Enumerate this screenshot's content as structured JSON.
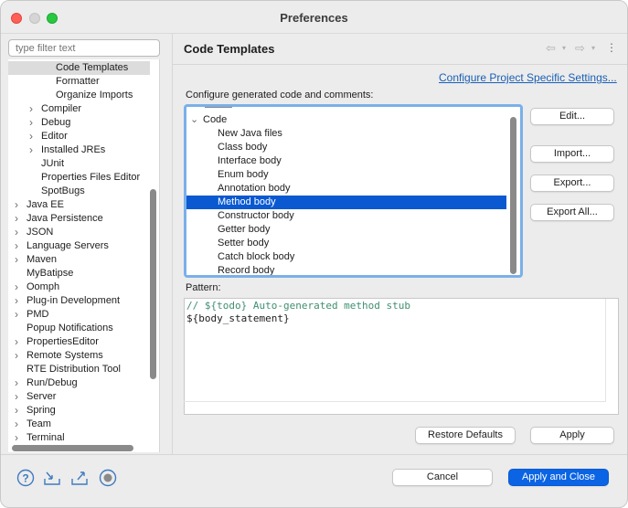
{
  "window": {
    "title": "Preferences"
  },
  "filter": {
    "placeholder": "type filter text"
  },
  "tree": [
    {
      "label": "Code Templates",
      "indent": 3,
      "chevron": "",
      "selected": true
    },
    {
      "label": "Formatter",
      "indent": 3,
      "chevron": ""
    },
    {
      "label": "Organize Imports",
      "indent": 3,
      "chevron": ""
    },
    {
      "label": "Compiler",
      "indent": 2,
      "chevron": "›"
    },
    {
      "label": "Debug",
      "indent": 2,
      "chevron": "›"
    },
    {
      "label": "Editor",
      "indent": 2,
      "chevron": "›"
    },
    {
      "label": "Installed JREs",
      "indent": 2,
      "chevron": "›"
    },
    {
      "label": "JUnit",
      "indent": 2,
      "chevron": ""
    },
    {
      "label": "Properties Files Editor",
      "indent": 2,
      "chevron": ""
    },
    {
      "label": "SpotBugs",
      "indent": 2,
      "chevron": ""
    },
    {
      "label": "Java EE",
      "indent": 1,
      "chevron": "›"
    },
    {
      "label": "Java Persistence",
      "indent": 1,
      "chevron": "›"
    },
    {
      "label": "JSON",
      "indent": 1,
      "chevron": "›"
    },
    {
      "label": "Language Servers",
      "indent": 1,
      "chevron": "›"
    },
    {
      "label": "Maven",
      "indent": 1,
      "chevron": "›"
    },
    {
      "label": "MyBatipse",
      "indent": 1,
      "chevron": ""
    },
    {
      "label": "Oomph",
      "indent": 1,
      "chevron": "›"
    },
    {
      "label": "Plug-in Development",
      "indent": 1,
      "chevron": "›"
    },
    {
      "label": "PMD",
      "indent": 1,
      "chevron": "›"
    },
    {
      "label": "Popup Notifications",
      "indent": 1,
      "chevron": ""
    },
    {
      "label": "PropertiesEditor",
      "indent": 1,
      "chevron": "›"
    },
    {
      "label": "Remote Systems",
      "indent": 1,
      "chevron": "›"
    },
    {
      "label": "RTE Distribution Tool",
      "indent": 1,
      "chevron": ""
    },
    {
      "label": "Run/Debug",
      "indent": 1,
      "chevron": "›"
    },
    {
      "label": "Server",
      "indent": 1,
      "chevron": "›"
    },
    {
      "label": "Spring",
      "indent": 1,
      "chevron": "›"
    },
    {
      "label": "Team",
      "indent": 1,
      "chevron": "›"
    },
    {
      "label": "Terminal",
      "indent": 1,
      "chevron": "›"
    }
  ],
  "page": {
    "title": "Code Templates",
    "link": "Configure Project Specific Settings...",
    "configure_label": "Configure generated code and comments:",
    "pattern_label": "Pattern:"
  },
  "templates": [
    {
      "label": "Code",
      "indent": 1,
      "chevron": "⌄"
    },
    {
      "label": "New Java files",
      "indent": 2
    },
    {
      "label": "Class body",
      "indent": 2
    },
    {
      "label": "Interface body",
      "indent": 2
    },
    {
      "label": "Enum body",
      "indent": 2
    },
    {
      "label": "Annotation body",
      "indent": 2
    },
    {
      "label": "Method body",
      "indent": 2,
      "selected": true
    },
    {
      "label": "Constructor body",
      "indent": 2
    },
    {
      "label": "Getter body",
      "indent": 2
    },
    {
      "label": "Setter body",
      "indent": 2
    },
    {
      "label": "Catch block body",
      "indent": 2
    },
    {
      "label": "Record body",
      "indent": 2
    }
  ],
  "side_buttons": {
    "edit": "Edit...",
    "import": "Import...",
    "export": "Export...",
    "export_all": "Export All..."
  },
  "pattern": {
    "line1": "// ${todo} Auto-generated method stub",
    "line2": "${body_statement}"
  },
  "footer": {
    "restore": "Restore Defaults",
    "apply": "Apply",
    "cancel": "Cancel",
    "apply_close": "Apply and Close"
  },
  "colors": {
    "accent": "#0a64e4",
    "selection": "#0a59d1",
    "comment": "#3f8f70",
    "link": "#1a5fb4"
  }
}
